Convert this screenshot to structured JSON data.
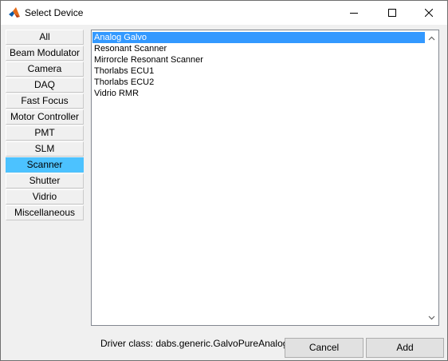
{
  "window": {
    "title": "Select Device"
  },
  "categories": [
    {
      "label": "All",
      "selected": false
    },
    {
      "label": "Beam Modulator",
      "selected": false
    },
    {
      "label": "Camera",
      "selected": false
    },
    {
      "label": "DAQ",
      "selected": false
    },
    {
      "label": "Fast Focus",
      "selected": false
    },
    {
      "label": "Motor Controller",
      "selected": false
    },
    {
      "label": "PMT",
      "selected": false
    },
    {
      "label": "SLM",
      "selected": false
    },
    {
      "label": "Scanner",
      "selected": true
    },
    {
      "label": "Shutter",
      "selected": false
    },
    {
      "label": "Vidrio",
      "selected": false
    },
    {
      "label": "Miscellaneous",
      "selected": false
    }
  ],
  "devices": [
    {
      "label": "Analog Galvo",
      "selected": true
    },
    {
      "label": "Resonant Scanner",
      "selected": false
    },
    {
      "label": "Mirrorcle Resonant Scanner",
      "selected": false
    },
    {
      "label": "Thorlabs ECU1",
      "selected": false
    },
    {
      "label": "Thorlabs ECU2",
      "selected": false
    },
    {
      "label": "Vidrio RMR",
      "selected": false
    }
  ],
  "footer": {
    "driver_class": "Driver class: dabs.generic.GalvoPureAnalog",
    "cancel_label": "Cancel",
    "add_label": "Add"
  },
  "colors": {
    "category_selected": "#4cc2ff",
    "list_selected": "#3399ff"
  },
  "icons": {
    "app": "matlab-icon",
    "minimize": "minimize-icon",
    "maximize": "maximize-icon",
    "close": "close-icon",
    "scroll_up": "chevron-up-icon",
    "scroll_down": "chevron-down-icon"
  }
}
